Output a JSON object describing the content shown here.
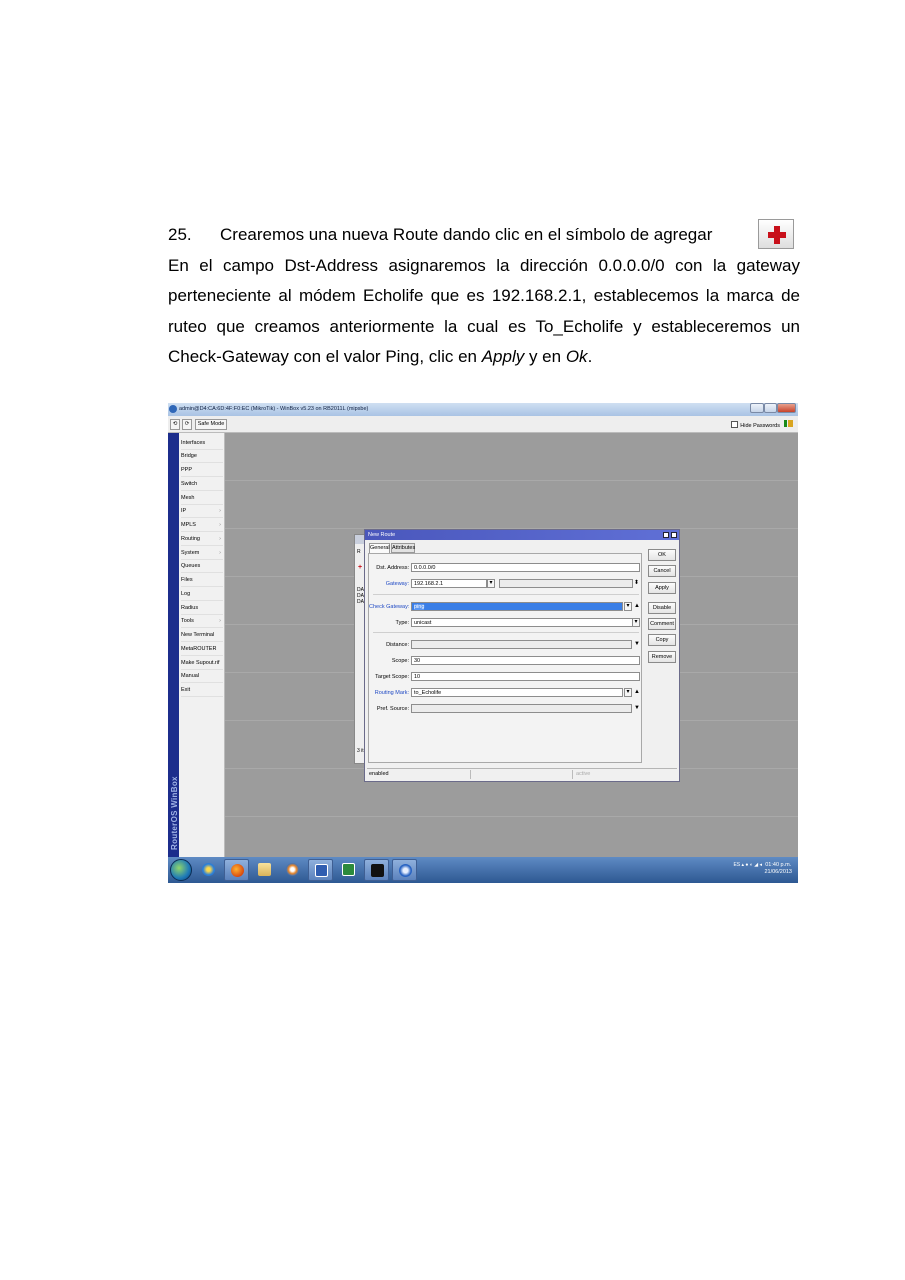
{
  "document": {
    "step_number": "25.",
    "line1": "Crearemos una nueva Route dando clic en el símbolo de agregar",
    "line2": "En el campo Dst-Address asignaremos la dirección  0.0.0.0/0 con la gateway",
    "line3": "perteneciente al módem Echolife que es 192.168.2.1, establecemos la marca de",
    "line4": "ruteo que creamos anteriormente la cual es To_Echolife y estableceremos un",
    "line5_a": "Check-Gateway con el valor Ping, clic en ",
    "line5_apply": "Apply",
    "line5_b": " y en ",
    "line5_ok": "Ok",
    "line5_end": ".",
    "add_icon": "red-plus-icon"
  },
  "screenshot": {
    "window_title": "admin@D4:CA:6D:4F:F0:EC (MikroTik) - WinBox v5.23 on RB2011L (mipsbe)",
    "toolbar": {
      "undo": "⟲",
      "redo": "⟳",
      "safe_mode": "Safe Mode",
      "hide_passwords": "Hide Passwords"
    },
    "sidebar_brand": "RouterOS WinBox",
    "menu": [
      {
        "label": "Interfaces",
        "arrow": ""
      },
      {
        "label": "Bridge",
        "arrow": ""
      },
      {
        "label": "PPP",
        "arrow": ""
      },
      {
        "label": "Switch",
        "arrow": ""
      },
      {
        "label": "Mesh",
        "arrow": ""
      },
      {
        "label": "IP",
        "arrow": "›"
      },
      {
        "label": "MPLS",
        "arrow": "›"
      },
      {
        "label": "Routing",
        "arrow": "›"
      },
      {
        "label": "System",
        "arrow": "›"
      },
      {
        "label": "Queues",
        "arrow": ""
      },
      {
        "label": "Files",
        "arrow": ""
      },
      {
        "label": "Log",
        "arrow": ""
      },
      {
        "label": "Radius",
        "arrow": ""
      },
      {
        "label": "Tools",
        "arrow": "›"
      },
      {
        "label": "New Terminal",
        "arrow": ""
      },
      {
        "label": "MetaROUTER",
        "arrow": ""
      },
      {
        "label": "Make Supout.rif",
        "arrow": ""
      },
      {
        "label": "Manual",
        "arrow": ""
      },
      {
        "label": "Exit",
        "arrow": ""
      }
    ],
    "back_window": {
      "label1": "R",
      "rows": "DA\nDA\nDA",
      "footer": "3 it"
    },
    "dialog": {
      "title": "New Route",
      "tabs": [
        "General",
        "Attributes"
      ],
      "fields": {
        "dst_address": {
          "label": "Dst. Address:",
          "value": "0.0.0.0/0"
        },
        "gateway": {
          "label": "Gateway:",
          "value": "192.168.2.1"
        },
        "check_gateway": {
          "label": "Check Gateway:",
          "value": "ping"
        },
        "type": {
          "label": "Type:",
          "value": "unicast"
        },
        "distance": {
          "label": "Distance:",
          "value": ""
        },
        "scope": {
          "label": "Scope:",
          "value": "30"
        },
        "target_scope": {
          "label": "Target Scope:",
          "value": "10"
        },
        "routing_mark": {
          "label": "Routing Mark:",
          "value": "to_Echolife"
        },
        "pref_source": {
          "label": "Pref. Source:",
          "value": ""
        }
      },
      "buttons": [
        "OK",
        "Cancel",
        "Apply",
        "Disable",
        "Comment",
        "Copy",
        "Remove"
      ],
      "status_left": "enabled",
      "status_right": "active"
    },
    "tray": {
      "lang": "ES",
      "time": "01:40 p.m.",
      "date": "21/06/2013"
    }
  }
}
